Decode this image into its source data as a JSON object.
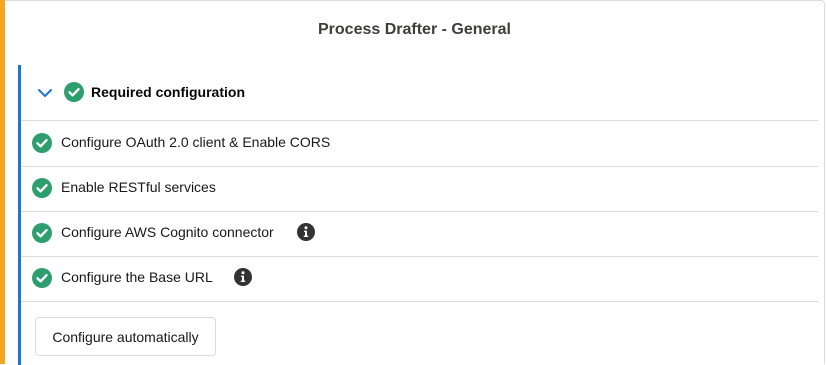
{
  "panel": {
    "title": "Process Drafter - General"
  },
  "section": {
    "title": "Required configuration",
    "items": [
      {
        "label": "Configure OAuth 2.0 client & Enable CORS",
        "status": "complete",
        "has_info": false
      },
      {
        "label": "Enable RESTful services",
        "status": "complete",
        "has_info": false
      },
      {
        "label": "Configure AWS Cognito connector",
        "status": "complete",
        "has_info": true
      },
      {
        "label": "Configure the Base URL",
        "status": "complete",
        "has_info": true
      }
    ]
  },
  "actions": {
    "configure_label": "Configure automatically"
  },
  "icons": {
    "check": "check-circle-icon",
    "info": "info-icon",
    "chevron": "chevron-down-icon"
  },
  "colors": {
    "accent_left": "#f5a623",
    "section_border": "#1b77d2",
    "success": "#2e9e6f",
    "info": "#333333"
  }
}
